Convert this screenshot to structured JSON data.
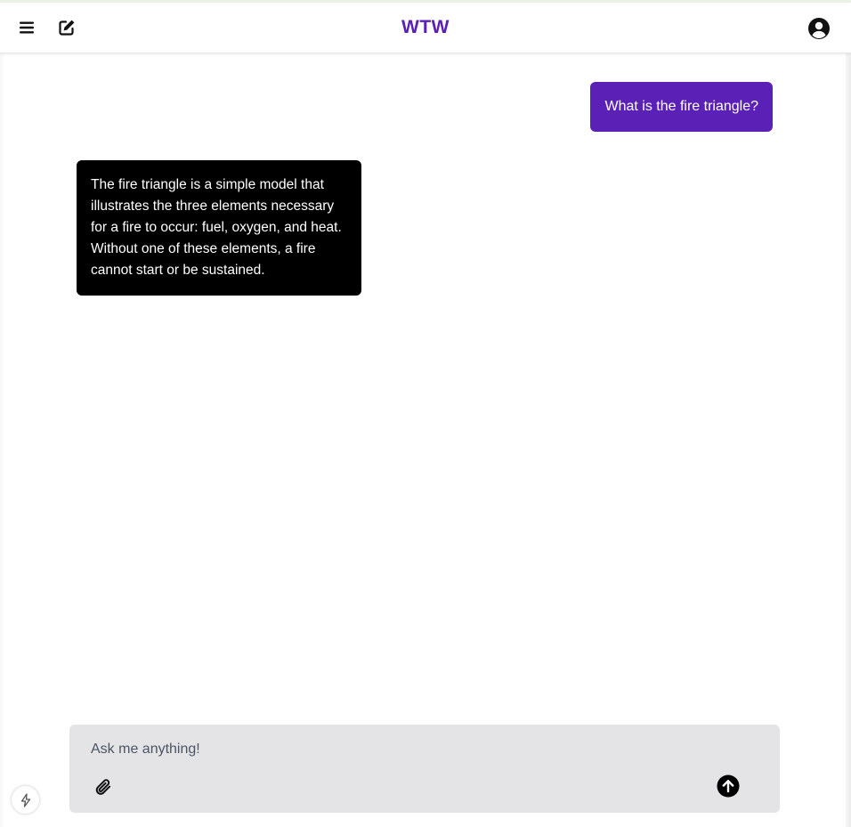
{
  "header": {
    "brand_title": "WTW",
    "brand_color": "#5b21b6",
    "icons": {
      "menu": "hamburger-menu-icon",
      "new_chat": "edit-pencil-icon",
      "account": "user-circle-icon"
    }
  },
  "conversation": {
    "messages": [
      {
        "role": "user",
        "text": "What is the fire triangle?",
        "bubble_color": "#5b21b6"
      },
      {
        "role": "assistant",
        "text": "The fire triangle is a simple model that illustrates the three elements necessary for a fire to occur: fuel, oxygen, and heat. Without one of these elements, a fire cannot start or be sustained.",
        "bubble_color": "#000000"
      }
    ]
  },
  "composer": {
    "placeholder": "Ask me anything!",
    "value": "",
    "background": "#e4e4e7",
    "icons": {
      "attach": "paperclip-icon",
      "send": "arrow-up-circle-icon"
    }
  },
  "floating": {
    "icon": "lightning-bolt-icon"
  }
}
